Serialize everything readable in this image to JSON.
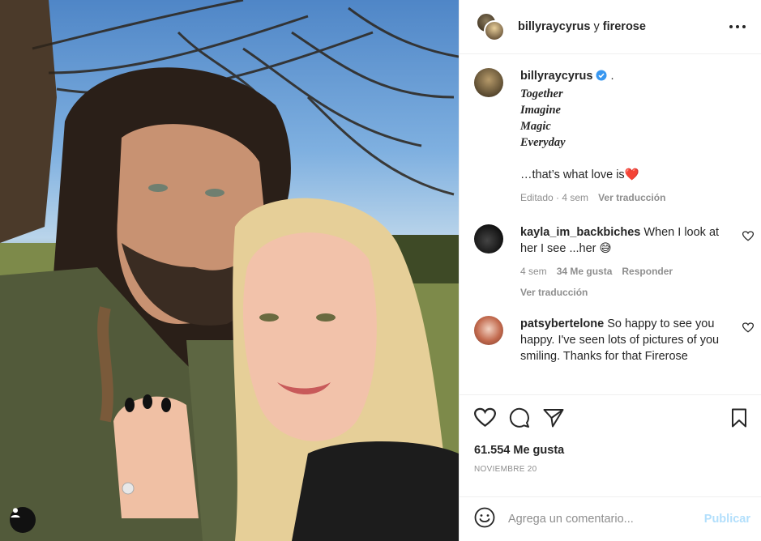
{
  "header": {
    "user1": "billyraycyrus",
    "conjunction": "y",
    "user2": "firerose"
  },
  "caption": {
    "username": "billyraycyrus",
    "dot": ".",
    "lines": [
      "Together",
      "Imagine",
      "Magic",
      "Everyday"
    ],
    "closing": "…that’s what love is",
    "emoji": "❤️",
    "edited": "Editado",
    "time": "4 sem",
    "translate": "Ver traducción"
  },
  "comments": [
    {
      "username": "kayla_im_backbiches",
      "text": "When I look at her I see ...her 😅",
      "time": "4 sem",
      "likes": "34 Me gusta",
      "reply": "Responder",
      "translate": "Ver traducción"
    },
    {
      "username": "patsybertelone",
      "text": "So happy to see you happy. I've seen lots of pictures of you smiling. Thanks for that Firerose"
    }
  ],
  "post": {
    "likes": "61.554 Me gusta",
    "date": "NOVIEMBRE 20"
  },
  "comment_input": {
    "placeholder": "Agrega un comentario...",
    "publish": "Publicar"
  },
  "icons": {
    "more": "more-options-icon",
    "like": "heart-icon",
    "comment": "comment-icon",
    "share": "paper-plane-icon",
    "save": "bookmark-icon",
    "emoji": "emoji-icon",
    "tags": "user-tag-icon",
    "verified": "verified-badge-icon"
  },
  "colors": {
    "verified": "#3897f0",
    "heart": "#e0245e",
    "publish_disabled": "#b2dffc",
    "muted": "#8e8e8e"
  }
}
